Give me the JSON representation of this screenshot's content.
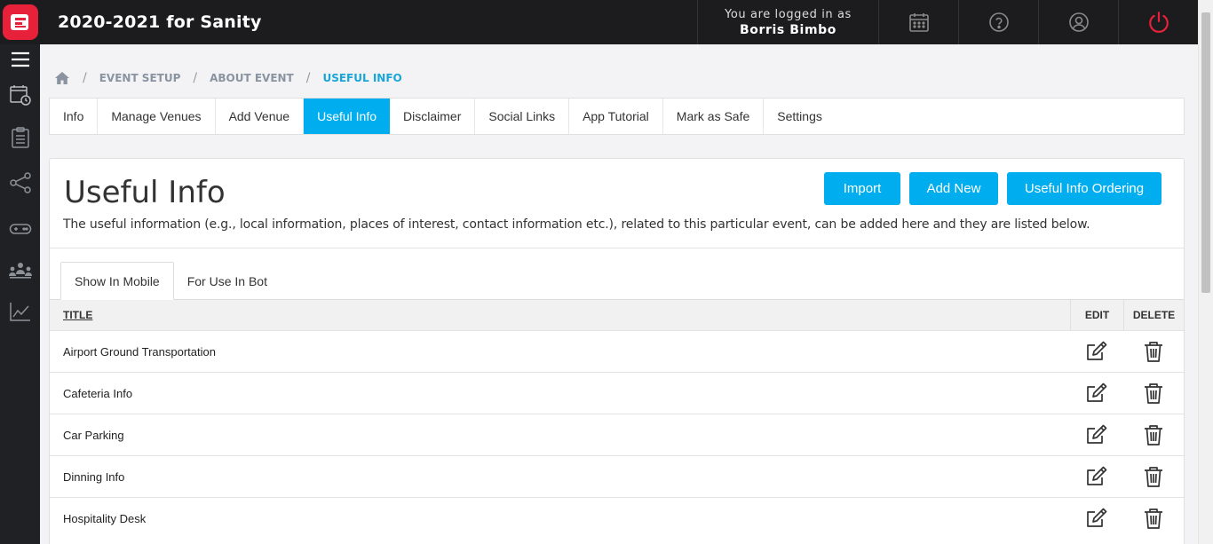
{
  "app": {
    "title": "2020-2021 for Sanity"
  },
  "header": {
    "logged_in_label": "You are logged in as",
    "user_name": "Borris Bimbo"
  },
  "breadcrumb": {
    "items": [
      "EVENT SETUP",
      "ABOUT EVENT",
      "USEFUL INFO"
    ],
    "separator": "/"
  },
  "subnav": {
    "tabs": [
      {
        "label": "Info"
      },
      {
        "label": "Manage Venues"
      },
      {
        "label": "Add Venue"
      },
      {
        "label": "Useful Info"
      },
      {
        "label": "Disclaimer"
      },
      {
        "label": "Social Links"
      },
      {
        "label": "App Tutorial"
      },
      {
        "label": "Mark as Safe"
      },
      {
        "label": "Settings"
      }
    ],
    "active": "Useful Info"
  },
  "panel": {
    "title": "Useful Info",
    "description": "The useful information (e.g., local information, places of interest, contact information etc.), related to this particular event, can be added here and they are listed below.",
    "buttons": {
      "import": "Import",
      "add_new": "Add New",
      "ordering": "Useful Info Ordering"
    },
    "tabs": [
      {
        "label": "Show In Mobile"
      },
      {
        "label": "For Use In Bot"
      }
    ],
    "active_tab": "Show In Mobile"
  },
  "table": {
    "columns": {
      "title": "TITLE",
      "edit": "EDIT",
      "delete": "DELETE"
    },
    "rows": [
      {
        "title": "Airport Ground Transportation"
      },
      {
        "title": "Cafeteria Info"
      },
      {
        "title": "Car Parking"
      },
      {
        "title": "Dinning Info"
      },
      {
        "title": "Hospitality Desk"
      }
    ]
  },
  "colors": {
    "accent": "#00aeef",
    "breadcrumb_active": "#18a6d8",
    "topbar": "#1c1c1e",
    "sidebar": "#1f2124",
    "logo": "#e8213a",
    "power": "#e8213a"
  },
  "icons": {
    "sidebar": [
      "menu-icon",
      "calendar-clock-icon",
      "clipboard-icon",
      "share-icon",
      "gamepad-icon",
      "people-icon",
      "chart-icon"
    ],
    "header": [
      "calendar-icon",
      "help-icon",
      "user-icon",
      "power-icon"
    ]
  }
}
